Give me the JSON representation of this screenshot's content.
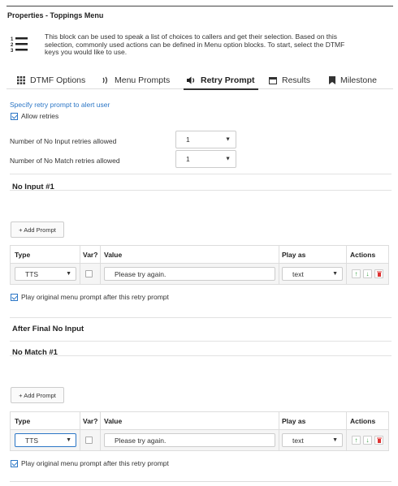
{
  "header": {
    "title": "Properties - Toppings Menu"
  },
  "info": {
    "icon": "numbered-list-icon",
    "text": "This block can be used to speak a list of choices to callers and get their selection. Based on this selection, commonly used actions can be defined in Menu option blocks. To start, select the DTMF keys you would like to use."
  },
  "tabs": [
    {
      "label": "DTMF Options",
      "icon": "grid-icon"
    },
    {
      "label": "Menu Prompts",
      "icon": "sound-icon"
    },
    {
      "label": "Retry Prompt",
      "icon": "speaker-icon"
    },
    {
      "label": "Results",
      "icon": "calendar-icon"
    },
    {
      "label": "Milestone",
      "icon": "bookmark-icon"
    }
  ],
  "active_tab": "Retry Prompt",
  "retry": {
    "link": "Specify retry prompt to alert user",
    "allow_label": "Allow retries",
    "allow_checked": true,
    "no_input_label": "Number of No Input retries allowed",
    "no_input_value": "1",
    "no_match_label": "Number of No Match retries allowed",
    "no_match_value": "1"
  },
  "no_input": {
    "heading": "No Input #1",
    "add_button": "+ Add Prompt",
    "columns": [
      "Type",
      "Var?",
      "Value",
      "Play as",
      "Actions"
    ],
    "row": {
      "type": "TTS",
      "var_checked": false,
      "value": "Please try again.",
      "play_as": "text"
    },
    "play_original_label": "Play original menu prompt after this retry prompt",
    "play_original_checked": true
  },
  "after_final": {
    "heading": "After Final No Input"
  },
  "no_match": {
    "heading": "No Match #1",
    "add_button": "+ Add Prompt",
    "columns": [
      "Type",
      "Var?",
      "Value",
      "Play as",
      "Actions"
    ],
    "row": {
      "type": "TTS",
      "var_checked": false,
      "value": "Please try again.",
      "play_as": "text"
    },
    "play_original_label": "Play original menu prompt after this retry prompt",
    "play_original_checked": true
  },
  "colors": {
    "accent": "#2b76c6",
    "action_arrow": "#2e9b3a",
    "action_delete": "#dd3333"
  }
}
